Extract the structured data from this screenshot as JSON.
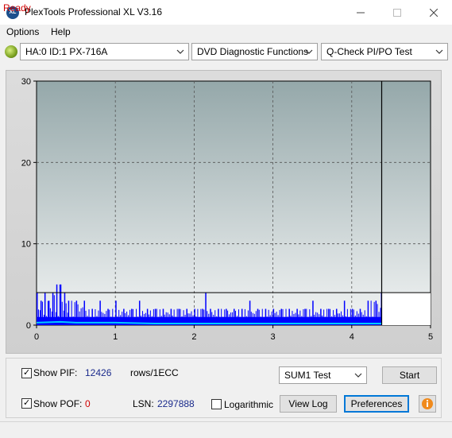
{
  "window": {
    "title": "PlexTools Professional XL V3.16",
    "icon_text": "XL"
  },
  "menu": {
    "items": [
      "Options",
      "Help"
    ]
  },
  "toolbar": {
    "drive": "HA:0 ID:1  PX-716A",
    "function": "DVD Diagnostic Functions",
    "test": "Q-Check PI/PO Test"
  },
  "chart_data": {
    "type": "bar",
    "xlim": [
      0,
      5
    ],
    "ylim": [
      0,
      30
    ],
    "x_ticks": [
      "0",
      "1",
      "2",
      "3",
      "4",
      "5"
    ],
    "y_ticks": [
      "0",
      "10",
      "20",
      "30"
    ],
    "grid": true,
    "end_marker_x": 4.38,
    "threshold": 4,
    "series": [
      {
        "color": "#0000ff",
        "x": [
          0.0,
          0.05,
          0.1,
          0.15,
          0.2,
          0.25,
          0.3,
          0.35,
          0.4,
          0.5,
          0.6,
          0.7,
          0.8,
          0.9,
          1.0,
          1.1,
          1.2,
          1.3,
          1.4,
          1.5,
          1.6,
          1.7,
          1.8,
          1.9,
          2.0,
          2.1,
          2.14,
          2.2,
          2.3,
          2.4,
          2.5,
          2.6,
          2.7,
          2.8,
          2.9,
          3.0,
          3.1,
          3.2,
          3.3,
          3.4,
          3.5,
          3.6,
          3.7,
          3.8,
          3.9,
          4.0,
          4.1,
          4.2,
          4.3,
          4.37
        ],
        "y": [
          4,
          3,
          4,
          3,
          4,
          5,
          5,
          4,
          3,
          3,
          3,
          2,
          3,
          2,
          3,
          2,
          2,
          3,
          2,
          2,
          2,
          2,
          2,
          2,
          2,
          2,
          4,
          2,
          2,
          2,
          2,
          2,
          3,
          2,
          2,
          2,
          2,
          2,
          2,
          2,
          3,
          2,
          2,
          2,
          3,
          2,
          2,
          3,
          3,
          4
        ]
      },
      {
        "color": "#00ccff",
        "x": [
          0.0,
          0.3,
          0.5,
          1.0,
          1.5,
          2.0,
          3.0,
          4.0,
          4.38
        ],
        "y": [
          0.3,
          0.4,
          0.3,
          0.3,
          0.2,
          0.2,
          0.2,
          0.2,
          0.2
        ]
      }
    ]
  },
  "controls": {
    "show_pif_label": "Show PIF:",
    "pif_value": "12426",
    "pif_unit": "rows/1ECC",
    "show_pof_label": "Show POF:",
    "pof_value": "0",
    "lsn_label": "LSN:",
    "lsn_value": "2297888",
    "logarithmic_label": "Logarithmic",
    "sum_test": "SUM1 Test",
    "start_label": "Start",
    "view_log_label": "View Log",
    "preferences_label": "Preferences"
  },
  "status": {
    "text": "Ready"
  }
}
